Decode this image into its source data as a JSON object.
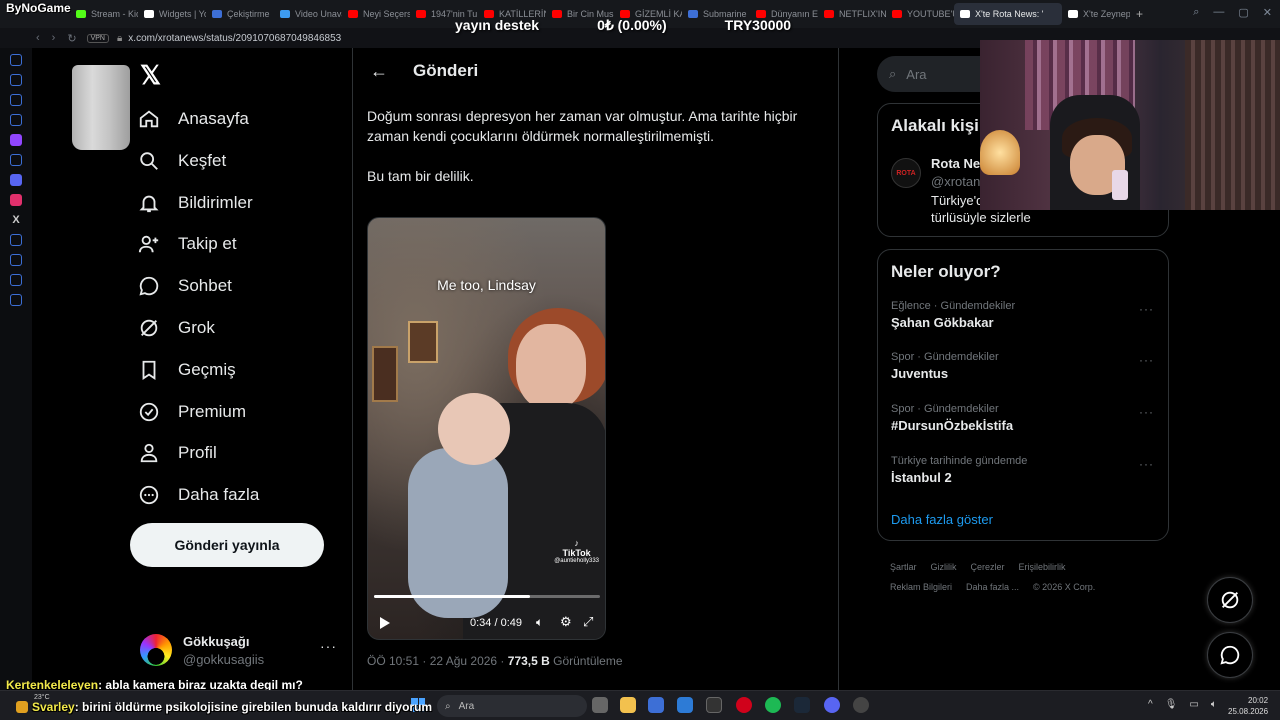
{
  "browser": {
    "tabs": [
      {
        "label": "Stream - Kic",
        "color": "#53fc18"
      },
      {
        "label": "Widgets | Yo",
        "color": "#ffffff"
      },
      {
        "label": "Çekiştirme",
        "color": "#3d6fd6"
      },
      {
        "label": "Video Unava",
        "color": "#3d9bf0"
      },
      {
        "label": "Neyi Seçers",
        "color": "#ff0000"
      },
      {
        "label": "1947'nin Tu",
        "color": "#ff0000"
      },
      {
        "label": "KATİLLERİN",
        "color": "#ff0000"
      },
      {
        "label": "Bir Cin Mus",
        "color": "#ff0000"
      },
      {
        "label": "GİZEMLİ KA",
        "color": "#ff0000"
      },
      {
        "label": "Submarine",
        "color": "#3d6fd6"
      },
      {
        "label": "Dünyanın E",
        "color": "#ff0000"
      },
      {
        "label": "NETFLIX'IN",
        "color": "#ff0000"
      },
      {
        "label": "YOUTUBE'U",
        "color": "#ff0000"
      },
      {
        "label": "X'te Rota News: '",
        "color": "#ffffff",
        "active": true
      },
      {
        "label": "X'te Zeynep",
        "color": "#ffffff"
      }
    ],
    "new_tab": "+",
    "url": "x.com/xrotanews/status/2091070687049846853",
    "vpn": "VPN"
  },
  "overlay": {
    "brand": "ByNoGame",
    "donation_label": "yayın destek",
    "donation_pct": "0₺ (0.00%)",
    "donation_goal": "TRY30000"
  },
  "nav": {
    "items": [
      {
        "label": "Anasayfa",
        "icon": "home-icon"
      },
      {
        "label": "Keşfet",
        "icon": "search-icon"
      },
      {
        "label": "Bildirimler",
        "icon": "bell-icon"
      },
      {
        "label": "Takip et",
        "icon": "add-user-icon"
      },
      {
        "label": "Sohbet",
        "icon": "chat-icon"
      },
      {
        "label": "Grok",
        "icon": "grok-icon"
      },
      {
        "label": "Geçmiş",
        "icon": "bookmark-icon"
      },
      {
        "label": "Premium",
        "icon": "verified-icon"
      },
      {
        "label": "Profil",
        "icon": "profile-icon"
      },
      {
        "label": "Daha fazla",
        "icon": "more-circle-icon"
      }
    ],
    "post_button": "Gönderi yayınla",
    "account": {
      "name": "Gökkuşağı",
      "handle": "@gokkusagiis",
      "more": "···"
    }
  },
  "post": {
    "header": "Gönderi",
    "paragraphs": [
      "Doğum sonrası depresyon her zaman var olmuştur. Ama tarihte hiçbir zaman kendi çocuklarını öldürmek normalleştirilmemişti.",
      "Bu tam bir delilik."
    ],
    "video": {
      "caption": "Me too, Lindsay",
      "watermark": "TikTok",
      "watermark_handle": "@auntieholly333",
      "time": "0:34 / 0:49",
      "progress": 0.69
    },
    "meta_time": "ÖÖ 10:51 · 22 Ağu 2026 · ",
    "views_value": "773,5 B",
    "views_label": " Görüntüleme"
  },
  "search": {
    "placeholder": "Ara"
  },
  "relevant": {
    "title": "Alakalı kişi",
    "name": "Rota New",
    "handle": "@xrotan",
    "bio1": "Türkiye'd",
    "bio2": "türlüsüyle sizlerle",
    "avatar_text": "ROTA"
  },
  "trends": {
    "title": "Neler oluyor?",
    "items": [
      {
        "context": "Eğlence · Gündemdekiler",
        "name": "Şahan Gökbakar"
      },
      {
        "context": "Spor · Gündemdekiler",
        "name": "Juventus"
      },
      {
        "context": "Spor · Gündemdekiler",
        "name": "#DursunÖzbekİstifa"
      },
      {
        "context": "Türkiye tarihinde gündemde",
        "name": "İstanbul 2"
      }
    ],
    "show_more": "Daha fazla göster"
  },
  "footer": {
    "links": [
      "Şartlar",
      "Gizlilik",
      "Çerezler",
      "Erişilebilirlik",
      "Reklam Bilgileri",
      "Daha fazla ...",
      "© 2026 X Corp."
    ]
  },
  "chat": [
    {
      "user": "Kertenkeleleyen",
      "message": ": abla kamera biraz uzakta degil mı?"
    },
    {
      "user": "Svarley",
      "message": ": birini öldürme psikolojisine girebilen bunuda kaldırır diyorum"
    }
  ],
  "taskbar": {
    "weather": "23°C",
    "search_placeholder": "Ara",
    "time": "20:02",
    "date": "25.08.2026"
  }
}
